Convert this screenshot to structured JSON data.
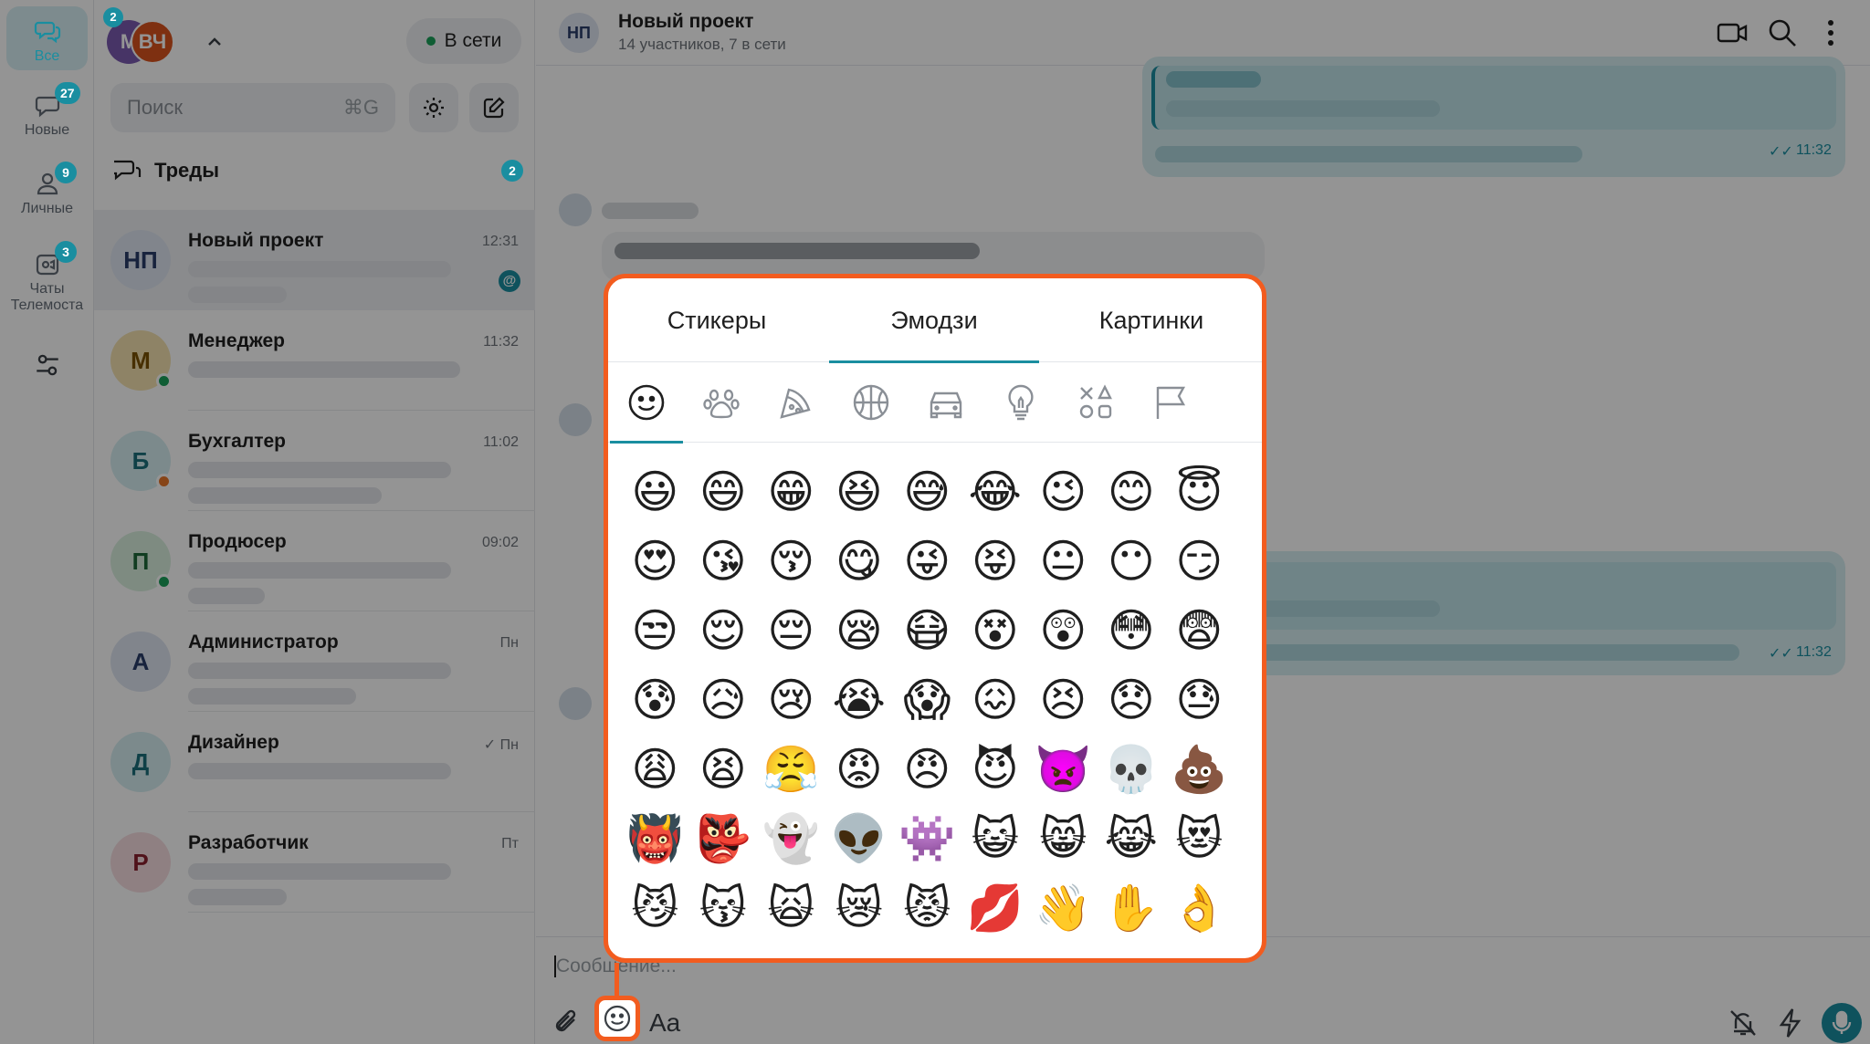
{
  "rail": {
    "items": [
      {
        "label": "Все",
        "badge": "",
        "icon": "chats-icon"
      },
      {
        "label": "Новые",
        "badge": "27",
        "icon": "new-messages-icon"
      },
      {
        "label": "Личные",
        "badge": "9",
        "icon": "person-icon"
      },
      {
        "label": "Чаты\nТелемоста",
        "badge": "3",
        "icon": "telemost-icon"
      }
    ],
    "account_badge": "2"
  },
  "panel": {
    "account_initials_back": "М",
    "account_initials_front": "ВЧ",
    "status": "В сети",
    "search_placeholder": "Поиск",
    "search_shortcut": "⌘G",
    "threads_label": "Треды",
    "threads_badge": "2",
    "chats": [
      {
        "initials": "НП",
        "name": "Новый проект",
        "time": "12:31",
        "mention": "@"
      },
      {
        "initials": "М",
        "name": "Менеджер",
        "time": "11:32"
      },
      {
        "initials": "Б",
        "name": "Бухгалтер",
        "time": "11:02"
      },
      {
        "initials": "П",
        "name": "Продюсер",
        "time": "09:02"
      },
      {
        "initials": "А",
        "name": "Администратор",
        "time": "Пн"
      },
      {
        "initials": "Д",
        "name": "Дизайнер",
        "time": "Пн",
        "read_check": "✓"
      },
      {
        "initials": "Р",
        "name": "Разработчик",
        "time": "Пт"
      }
    ]
  },
  "conversation": {
    "initials": "НП",
    "title": "Новый проект",
    "subtitle": "14 участников, 7 в сети",
    "message_times": [
      "11:32",
      "11:32"
    ],
    "read_marks": [
      "✓✓",
      "✓✓"
    ],
    "composer_placeholder": "Сообщение...",
    "format_label": "Aa"
  },
  "picker": {
    "tabs": [
      "Стикеры",
      "Эмодзи",
      "Картинки"
    ],
    "active_tab": "Эмодзи",
    "categories": [
      "smileys-icon",
      "animals-icon",
      "food-icon",
      "sports-icon",
      "travel-icon",
      "objects-icon",
      "symbols-icon",
      "flags-icon"
    ],
    "emojis": [
      "😃",
      "😄",
      "😁",
      "😆",
      "😅",
      "😂",
      "😉",
      "😊",
      "😇",
      "😍",
      "😘",
      "😚",
      "😋",
      "😜",
      "😝",
      "😐",
      "😶",
      "😏",
      "😒",
      "😌",
      "😔",
      "😪",
      "😷",
      "😵",
      "😲",
      "😳",
      "😨",
      "😰",
      "😥",
      "😢",
      "😭",
      "😱",
      "😖",
      "😣",
      "😞",
      "😓",
      "😩",
      "😫",
      "😤",
      "😡",
      "😠",
      "😈",
      "👿",
      "💀",
      "💩",
      "👹",
      "👺",
      "👻",
      "👽",
      "👾",
      "😺",
      "😸",
      "😹",
      "😻",
      "😼",
      "😽",
      "🙀",
      "😿",
      "😾",
      "💋",
      "👋",
      "✋",
      "👌"
    ]
  },
  "colors": {
    "accent": "#1a8ea0",
    "highlight": "#f25c1f",
    "online": "#1aa05a",
    "away": "#e8782a"
  }
}
